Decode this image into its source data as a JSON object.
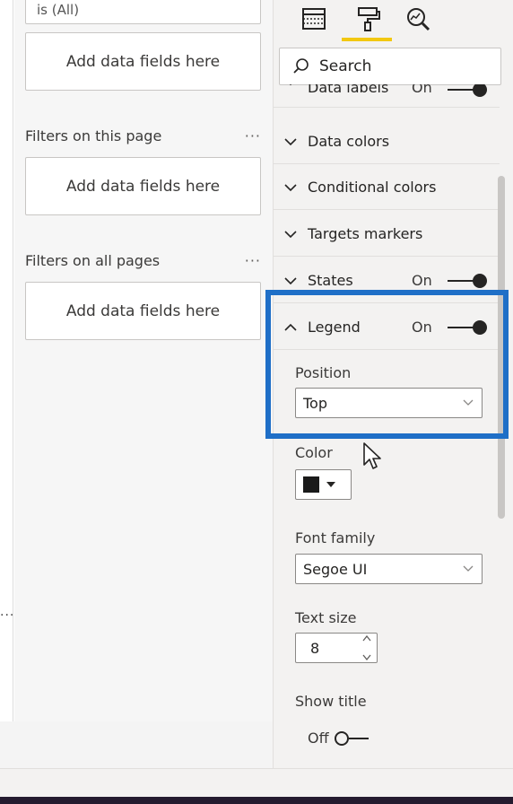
{
  "filters": {
    "top_filter_text": "is (All)",
    "add_fields_label_1": "Add data fields here",
    "section_page": "Filters on this page",
    "add_fields_label_2": "Add data fields here",
    "section_all": "Filters on all pages",
    "add_fields_label_3": "Add data fields here",
    "more": "···"
  },
  "left_more": "···",
  "format_pane": {
    "search_placeholder": "Search",
    "cards": [
      {
        "label": "Data labels",
        "state": "On"
      },
      {
        "label": "Data colors"
      },
      {
        "label": "Conditional colors"
      },
      {
        "label": "Targets markers"
      },
      {
        "label": "States",
        "state": "On"
      },
      {
        "label": "Legend",
        "state": "On"
      }
    ],
    "legend": {
      "position_label": "Position",
      "position_value": "Top",
      "color_label": "Color",
      "color_value": "#1a1a1a",
      "font_family_label": "Font family",
      "font_family_value": "Segoe UI",
      "text_size_label": "Text size",
      "text_size_value": "8",
      "show_title_label": "Show title",
      "show_title_state": "Off"
    }
  },
  "colors": {
    "highlight": "#1f6fc7",
    "tab_accent": "#f2c811"
  }
}
